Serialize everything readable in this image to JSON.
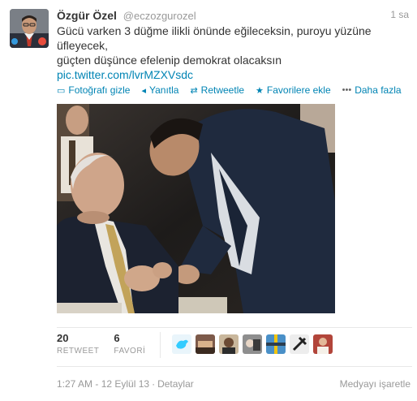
{
  "author": {
    "name": "Özgür Özel",
    "handle": "@eczozgurozel"
  },
  "tweet": {
    "time": "1 sa",
    "lines": [
      "Gücü varken 3 düğme ilikli önünde eğileceksin, puroyu yüzüne",
      "üfleyecek,",
      "güçten düşünce efelenip demokrat olacaksın"
    ],
    "link": "pic.twitter.com/lvrMZXVsdc"
  },
  "actions": {
    "hide_photo": "Fotoğrafı gizle",
    "reply": "Yanıtla",
    "retweet": "Retweetle",
    "favorite": "Favorilere ekle",
    "more": "Daha fazla"
  },
  "stats": {
    "retweets": "20",
    "retweet_label": "RETWEET",
    "favorites": "6",
    "favorite_label": "FAVORİ"
  },
  "footer": {
    "timestamp": "1:27 AM - 12 Eylül 13",
    "details": "Detaylar",
    "flag_media": "Medyayı işaretle"
  },
  "icons": {
    "hide_photo": "photo-icon",
    "reply": "reply-icon",
    "retweet": "retweet-icon",
    "favorite": "star-icon",
    "more": "more-dots-icon"
  },
  "colors": {
    "link": "#0084b4",
    "muted": "#999999",
    "text": "#333333"
  }
}
